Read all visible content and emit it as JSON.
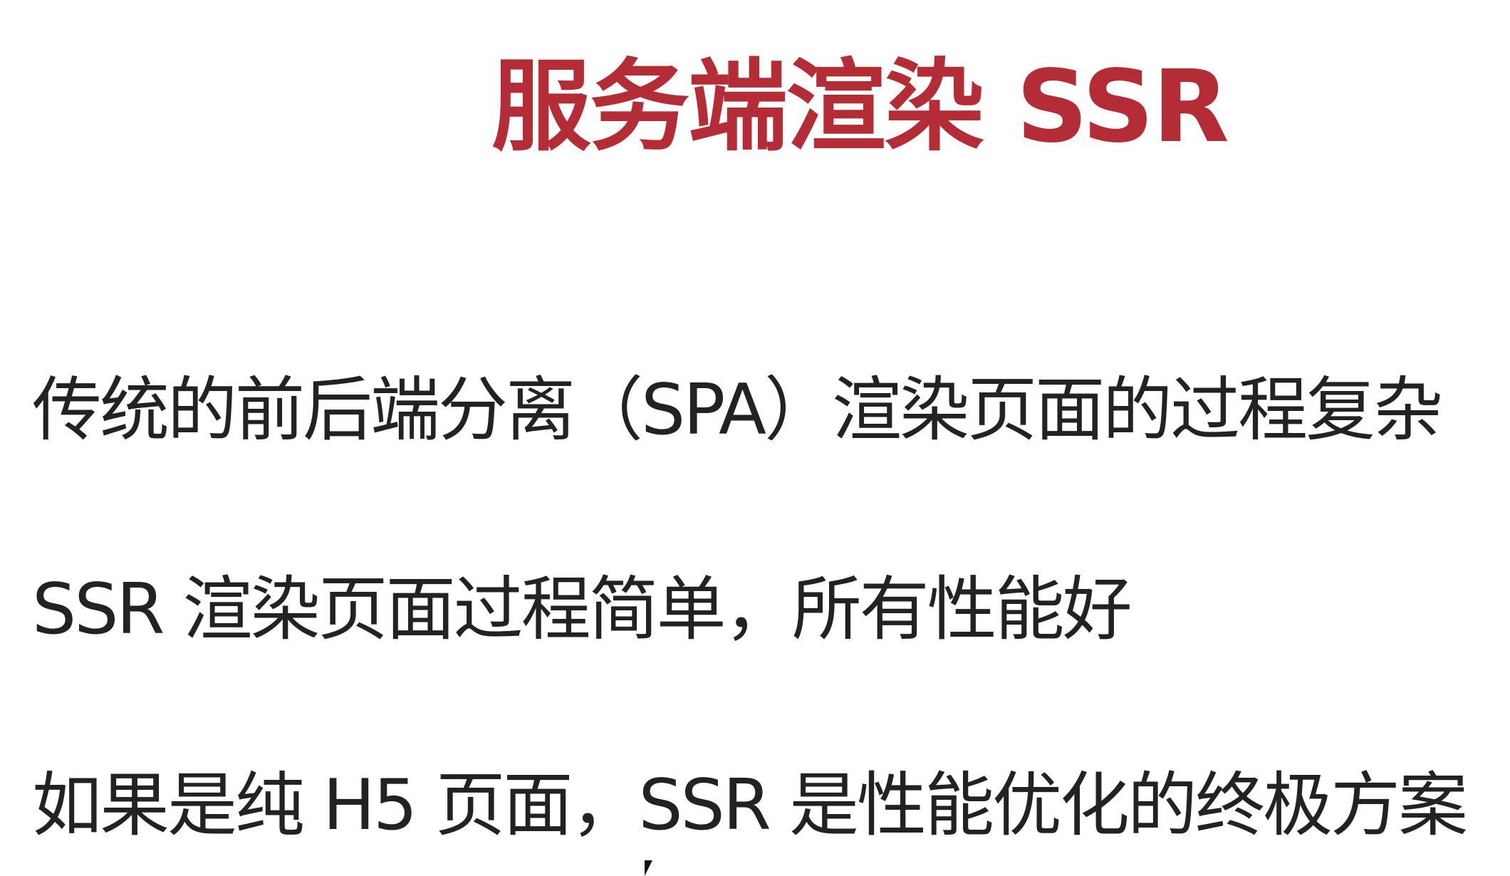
{
  "slide": {
    "title": "服务端渲染 SSR",
    "bullets": [
      "传统的前后端分离（SPA）渲染页面的过程复杂",
      "SSR 渲染页面过程简单，所有性能好",
      "如果是纯 H5 页面，SSR 是性能优化的终极方案"
    ]
  },
  "colors": {
    "title": "#b42c36",
    "text": "#222222",
    "background": "#ffffff"
  },
  "icons": {
    "cursor": "mouse-pointer-icon"
  }
}
